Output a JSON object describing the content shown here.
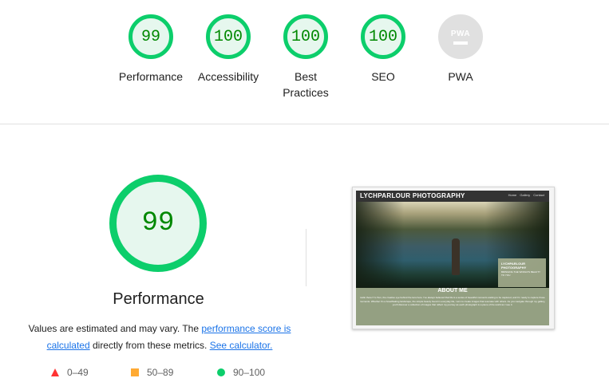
{
  "scores": [
    {
      "value": "99",
      "label": "Performance"
    },
    {
      "value": "100",
      "label": "Accessibility"
    },
    {
      "value": "100",
      "label": "Best Practices"
    },
    {
      "value": "100",
      "label": "SEO"
    },
    {
      "value": "PWA",
      "label": "PWA"
    }
  ],
  "performance": {
    "score": "99",
    "title": "Performance",
    "desc_pre": "Values are estimated and may vary. The ",
    "desc_link1": "performance score is calculated",
    "desc_mid": " directly from these metrics. ",
    "desc_link2": "See calculator."
  },
  "legend": [
    {
      "range": "0–49",
      "icon": "red-triangle-icon",
      "color": "#ff3333"
    },
    {
      "range": "50–89",
      "icon": "orange-square-icon",
      "color": "#ffaa33"
    },
    {
      "range": "90–100",
      "icon": "green-circle-icon",
      "color": "#0cce6b"
    }
  ],
  "thumbnail": {
    "brand": "LYCHPARLOUR PHOTOGRAPHY",
    "nav": [
      "Home",
      "Gallery",
      "Contact"
    ],
    "overlay_title": "LYCHPARLOUR PHOTOGRAPHY",
    "overlay_sub": "BRINGING THE WORLD'S BEAUTY TO YOU",
    "about_heading": "ABOUT ME",
    "about_text": "Hello there! I'm Tom, the creative eye behind the lens here. I've always believed that life is a series of beautiful moments waiting to be captured, and I'm ready to capture those moments. Whether it's a breathtaking landscape, the simple beauty found in everyday life, I aim to create images that resonate with others. As you navigate through my gallery, you'll discover a collection of images that reflect my journey as each photograph is a piece of the world as I see it."
  },
  "colors": {
    "pass": "#0cce6b",
    "pass_bg": "#e6f7ee",
    "pass_text": "#008800",
    "link": "#1a73e8"
  }
}
